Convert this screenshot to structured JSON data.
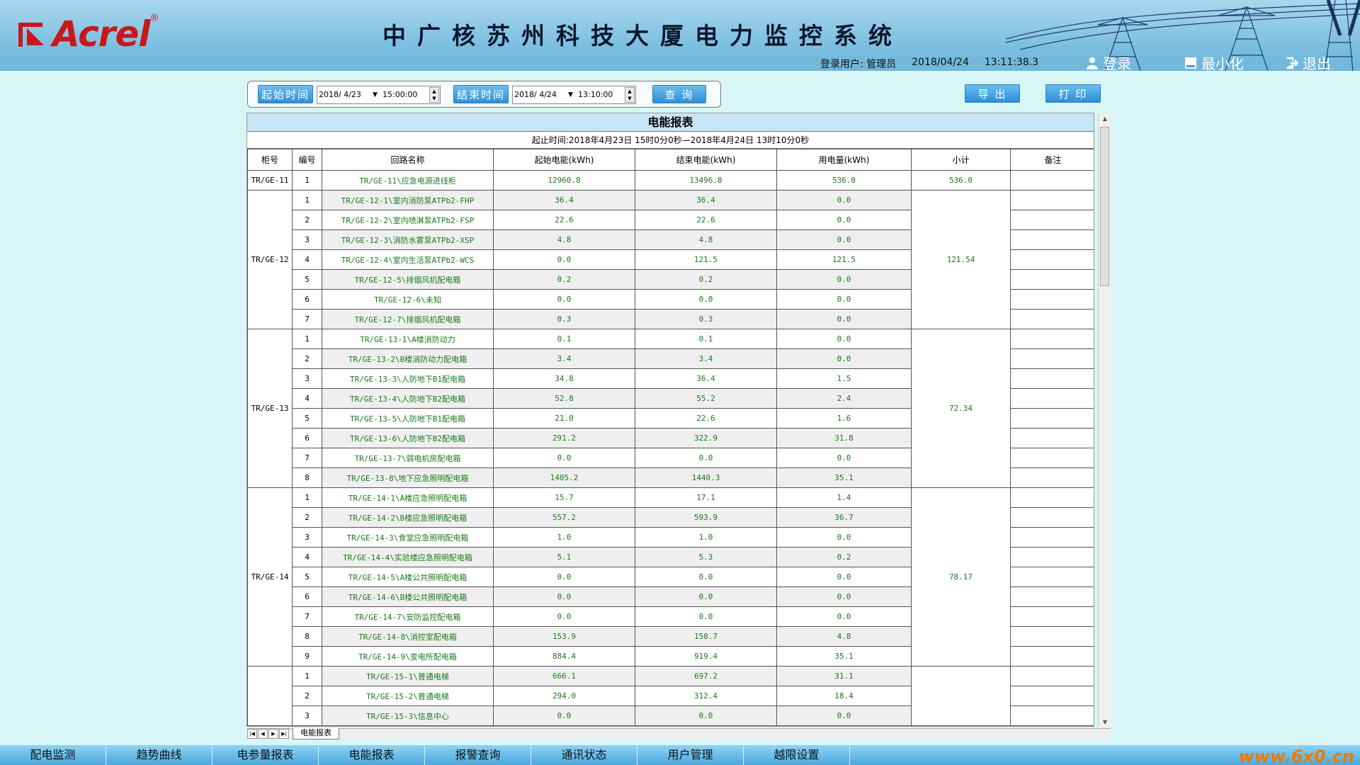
{
  "header": {
    "logo_text": "Acrel",
    "logo_reg": "®",
    "system_title": "中广核苏州科技大厦电力监控系统",
    "login_user_label": "登录用户:",
    "login_user": "管理员",
    "date": "2018/04/24",
    "time": "13:11:38.3",
    "login_label": "登录",
    "minimize_label": "最小化",
    "exit_label": "退出"
  },
  "toolbar": {
    "start_label": "起始时间",
    "start_date": "2018/ 4/23",
    "start_time": "15:00:00",
    "end_label": "结束时间",
    "end_date": "2018/ 4/24",
    "end_time": "13:10:00",
    "query_label": "查 询",
    "export_label": "导 出",
    "print_label": "打 印"
  },
  "report": {
    "title": "电能报表",
    "subtitle": "起止时间:2018年4月23日  15时0分0秒—2018年4月24日  13时10分0秒",
    "columns": [
      "柜号",
      "编号",
      "回路名称",
      "起始电能(kWh)",
      "结束电能(kWh)",
      "用电量(kWh)",
      "小计",
      "备注"
    ],
    "groups": [
      {
        "cabinet": "TR/GE-11",
        "subtotal": "536.0",
        "rows": [
          [
            "1",
            "TR/GE-11\\应急电源进线柜",
            "12960.8",
            "13496.8",
            "536.0"
          ]
        ]
      },
      {
        "cabinet": "TR/GE-12",
        "subtotal": "121.54",
        "rows": [
          [
            "1",
            "TR/GE-12-1\\室内消防泵ATPb2-FHP",
            "36.4",
            "36.4",
            "0.0"
          ],
          [
            "2",
            "TR/GE-12-2\\室内喷淋泵ATPb2-FSP",
            "22.6",
            "22.6",
            "0.0"
          ],
          [
            "3",
            "TR/GE-12-3\\消防水雾泵ATPb2-XSP",
            "4.8",
            "4.8",
            "0.0"
          ],
          [
            "4",
            "TR/GE-12-4\\室内生活泵ATPb2-WCS",
            "0.0",
            "121.5",
            "121.5"
          ],
          [
            "5",
            "TR/GE-12-5\\排烟风机配电箱",
            "0.2",
            "0.2",
            "0.0"
          ],
          [
            "6",
            "TR/GE-12-6\\未知",
            "0.0",
            "0.0",
            "0.0"
          ],
          [
            "7",
            "TR/GE-12-7\\排烟风机配电箱",
            "0.3",
            "0.3",
            "0.0"
          ]
        ]
      },
      {
        "cabinet": "TR/GE-13",
        "subtotal": "72.34",
        "rows": [
          [
            "1",
            "TR/GE-13-1\\A楼消防动力",
            "0.1",
            "0.1",
            "0.0"
          ],
          [
            "2",
            "TR/GE-13-2\\B楼消防动力配电箱",
            "3.4",
            "3.4",
            "0.0"
          ],
          [
            "3",
            "TR/GE-13-3\\人防地下B1配电箱",
            "34.8",
            "36.4",
            "1.5"
          ],
          [
            "4",
            "TR/GE-13-4\\人防地下B2配电箱",
            "52.8",
            "55.2",
            "2.4"
          ],
          [
            "5",
            "TR/GE-13-5\\人防地下B1配电箱",
            "21.0",
            "22.6",
            "1.6"
          ],
          [
            "6",
            "TR/GE-13-6\\人防地下B2配电箱",
            "291.2",
            "322.9",
            "31.8"
          ],
          [
            "7",
            "TR/GE-13-7\\弱电机房配电箱",
            "0.0",
            "0.0",
            "0.0"
          ],
          [
            "8",
            "TR/GE-13-8\\地下应急照明配电箱",
            "1405.2",
            "1440.3",
            "35.1"
          ]
        ]
      },
      {
        "cabinet": "TR/GE-14",
        "subtotal": "78.17",
        "rows": [
          [
            "1",
            "TR/GE-14-1\\A楼应急照明配电箱",
            "15.7",
            "17.1",
            "1.4"
          ],
          [
            "2",
            "TR/GE-14-2\\B楼应急照明配电箱",
            "557.2",
            "593.9",
            "36.7"
          ],
          [
            "3",
            "TR/GE-14-3\\食堂应急照明配电箱",
            "1.0",
            "1.0",
            "0.0"
          ],
          [
            "4",
            "TR/GE-14-4\\实验楼应急照明配电箱",
            "5.1",
            "5.3",
            "0.2"
          ],
          [
            "5",
            "TR/GE-14-5\\A楼公共照明配电箱",
            "0.0",
            "0.0",
            "0.0"
          ],
          [
            "6",
            "TR/GE-14-6\\B楼公共照明配电箱",
            "0.0",
            "0.0",
            "0.0"
          ],
          [
            "7",
            "TR/GE-14-7\\安防监控配电箱",
            "0.0",
            "0.0",
            "0.0"
          ],
          [
            "8",
            "TR/GE-14-8\\消控室配电箱",
            "153.9",
            "158.7",
            "4.8"
          ],
          [
            "9",
            "TR/GE-14-9\\变电所配电箱",
            "884.4",
            "919.4",
            "35.1"
          ]
        ]
      },
      {
        "cabinet": "",
        "subtotal": "",
        "rows": [
          [
            "1",
            "TR/GE-15-1\\普通电梯",
            "666.1",
            "697.2",
            "31.1"
          ],
          [
            "2",
            "TR/GE-15-2\\普通电梯",
            "294.0",
            "312.4",
            "18.4"
          ],
          [
            "3",
            "TR/GE-15-3\\信息中心",
            "0.0",
            "0.0",
            "0.0"
          ]
        ]
      }
    ],
    "sheet_tab": "电能报表"
  },
  "bottom_nav": [
    "配电监测",
    "趋势曲线",
    "电参量报表",
    "电能报表",
    "报警查询",
    "通讯状态",
    "用户管理",
    "越限设置"
  ],
  "watermark": "www.6x0.cn",
  "colors": {
    "value_text": "#1a7a1a",
    "header_bg": "#79bddf",
    "page_bg": "#d9f6f6",
    "logo_red": "#c8181c"
  }
}
